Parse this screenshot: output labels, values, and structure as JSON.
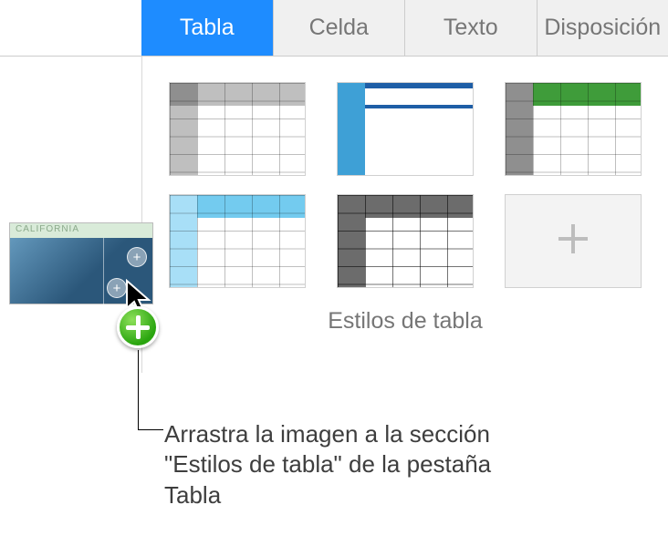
{
  "tabs": {
    "tabla": "Tabla",
    "celda": "Celda",
    "texto": "Texto",
    "disposicion": "Disposición"
  },
  "panel": {
    "section_label": "Estilos de tabla"
  },
  "drag_thumb": {
    "title": "CALIFORNIA"
  },
  "caption": {
    "text": "Arrastra la imagen a la sección \"Estilos de tabla\" de la pestaña Tabla"
  }
}
